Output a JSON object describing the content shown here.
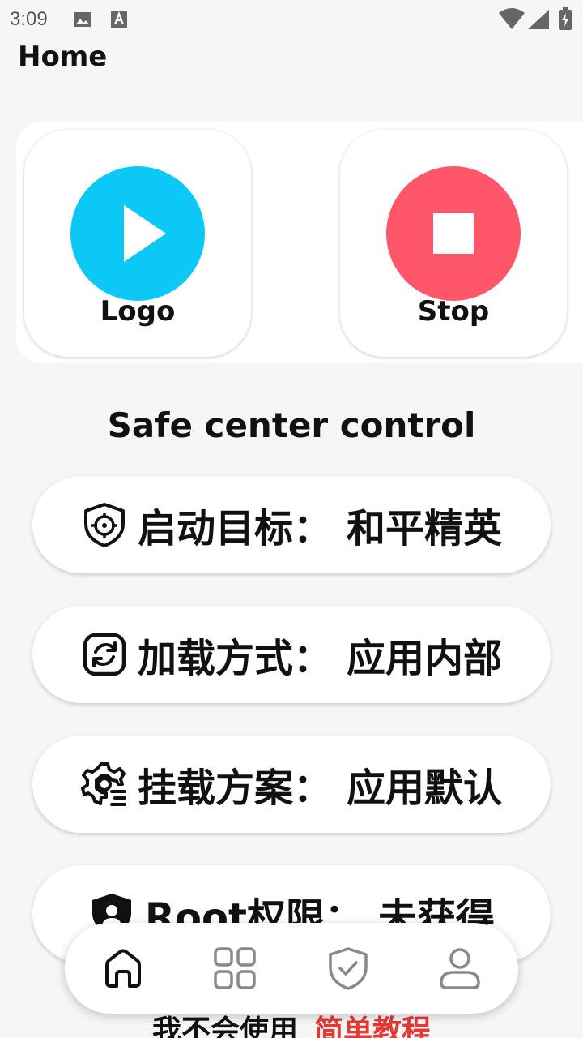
{
  "status_bar": {
    "time": "3:09",
    "icons": [
      "image-notification-icon",
      "font-notification-icon",
      "wifi-icon",
      "cellular-signal-icon",
      "battery-charging-icon"
    ]
  },
  "header": {
    "title": "Home"
  },
  "tiles": [
    {
      "label": "Logo",
      "icon": "play-icon",
      "color": "#0bc8f6"
    },
    {
      "label": "Stop",
      "icon": "stop-icon",
      "color": "#ff566a"
    }
  ],
  "section": {
    "title": "Safe center control"
  },
  "options": [
    {
      "key": "启动目标：",
      "value": "和平精英",
      "icon": "target-shield-icon"
    },
    {
      "key": "加载方式：",
      "value": "应用内部",
      "icon": "sync-icon"
    },
    {
      "key": "挂载方案：",
      "value": "应用默认",
      "icon": "gear-icon"
    },
    {
      "key": "Root权限：",
      "value": "未获得",
      "icon": "shield-user-icon"
    }
  ],
  "help": {
    "question": "我不会使用",
    "link": "简单教程"
  },
  "nav": {
    "items": [
      "home-icon",
      "apps-grid-icon",
      "shield-check-icon",
      "profile-icon"
    ],
    "active": "home-icon"
  },
  "colors": {
    "accent_link": "#e53935",
    "background": "#f6f6f6"
  }
}
